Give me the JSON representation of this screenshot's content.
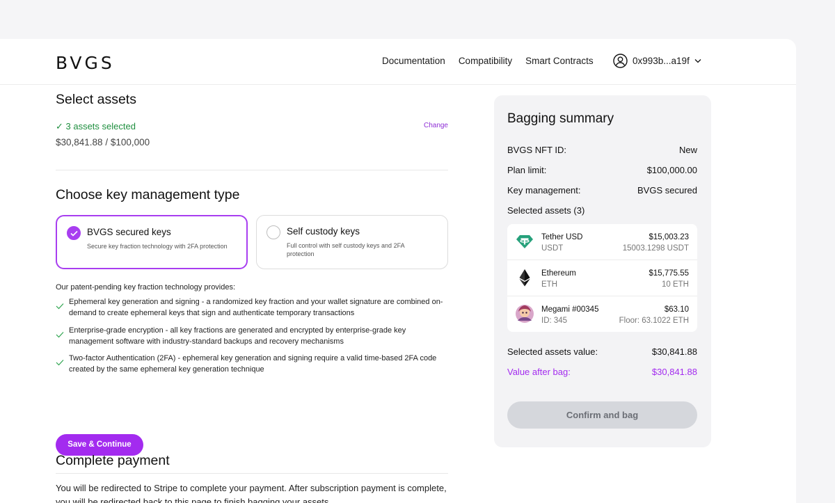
{
  "header": {
    "logo": "BVGS",
    "nav": [
      "Documentation",
      "Compatibility",
      "Smart Contracts"
    ],
    "wallet": "0x993b...a19f"
  },
  "select_assets": {
    "title": "Select assets",
    "selected": "✓ 3 assets selected",
    "change": "Change",
    "value": "$30,841.88 / $100,000"
  },
  "key_management": {
    "title": "Choose key management type",
    "options": [
      {
        "title": "BVGS secured keys",
        "desc": "Secure key fraction technology with 2FA protection",
        "selected": true
      },
      {
        "title": "Self custody keys",
        "desc": "Full control with self custody keys and 2FA protection",
        "selected": false
      }
    ],
    "intro": "Our patent-pending key fraction technology provides:",
    "features": [
      "Ephemeral key generation and signing - a randomized key fraction and your wallet signature are combined on-demand to create ephemeral keys that sign and authenticate temporary transactions",
      "Enterprise-grade encryption - all key fractions are generated and encrypted by enterprise-grade key management software with industry-standard backups and recovery mechanisms",
      "Two-factor Authentication (2FA) - ephemeral key generation and signing require a valid time-based 2FA code created by the same ephemeral key generation technique"
    ],
    "save_label": "Save & Continue"
  },
  "payment": {
    "title": "Complete payment",
    "text": "You will be redirected to Stripe to complete your payment. After subscription payment is complete, you will be redirected back to this page to finish bagging your assets."
  },
  "summary": {
    "title": "Bagging summary",
    "rows": [
      {
        "label": "BVGS NFT ID:",
        "value": "New"
      },
      {
        "label": "Plan limit:",
        "value": "$100,000.00"
      },
      {
        "label": "Key management:",
        "value": "BVGS secured"
      }
    ],
    "selected_label": "Selected assets (3)",
    "assets": [
      {
        "name": "Tether USD",
        "sub": "USDT",
        "value": "$15,003.23",
        "amount": "15003.1298 USDT",
        "icon": "tether-icon"
      },
      {
        "name": "Ethereum",
        "sub": "ETH",
        "value": "$15,775.55",
        "amount": "10 ETH",
        "icon": "ethereum-icon"
      },
      {
        "name": "Megami #00345",
        "sub": "ID: 345",
        "value": "$63.10",
        "amount": "Floor: 63.1022 ETH",
        "icon": "megami-nft-icon"
      }
    ],
    "assets_value_label": "Selected assets value:",
    "assets_value": "$30,841.88",
    "after_label": "Value after bag:",
    "after_value": "$30,841.88",
    "confirm_label": "Confirm and bag"
  },
  "colors": {
    "accent": "#a32bef",
    "success": "#1e8e3e",
    "disabled_button": "#d5d7dc"
  }
}
